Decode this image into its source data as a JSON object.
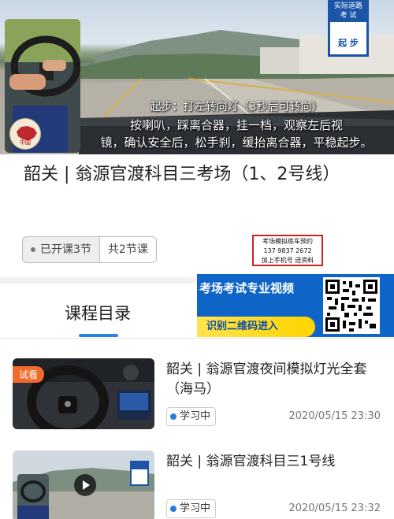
{
  "hero": {
    "sign_top_line1": "实际道路",
    "sign_top_line2": "考 试",
    "sign_bottom": "起 步",
    "caption1": "起步：打左转向灯（3秒后可转向）",
    "caption2": "按喇叭，踩离合器，挂一档，观察左后视",
    "caption3": "镜，确认安全后，松手刹，缓抬离合器，平稳起步。",
    "badge_text": "中国"
  },
  "course": {
    "title": "韶关 | 翁源官渡科目三考场（1、2号线）",
    "opened": "已开课3节",
    "total": "共2节课"
  },
  "promo_note": {
    "line1": "考场模拟练车预约",
    "line2": "137 9837 2672",
    "line3": "加上手机号  送资料"
  },
  "banner": {
    "title": "考场考试专业视频",
    "button": "识别二维码进入",
    "accent": "#0f64c8"
  },
  "tabs": {
    "catalog": "课程目录",
    "underline_color": "#2a82e4"
  },
  "lessons": [
    {
      "badge": "试看",
      "title": "韶关 | 翁源官渡夜间模拟灯光全套（海马）",
      "status": "学习中",
      "time": "2020/05/15 23:30"
    },
    {
      "badge": "",
      "title": "韶关 | 翁源官渡科目三1号线",
      "status": "学习中",
      "time": "2020/05/15 23:32"
    }
  ]
}
